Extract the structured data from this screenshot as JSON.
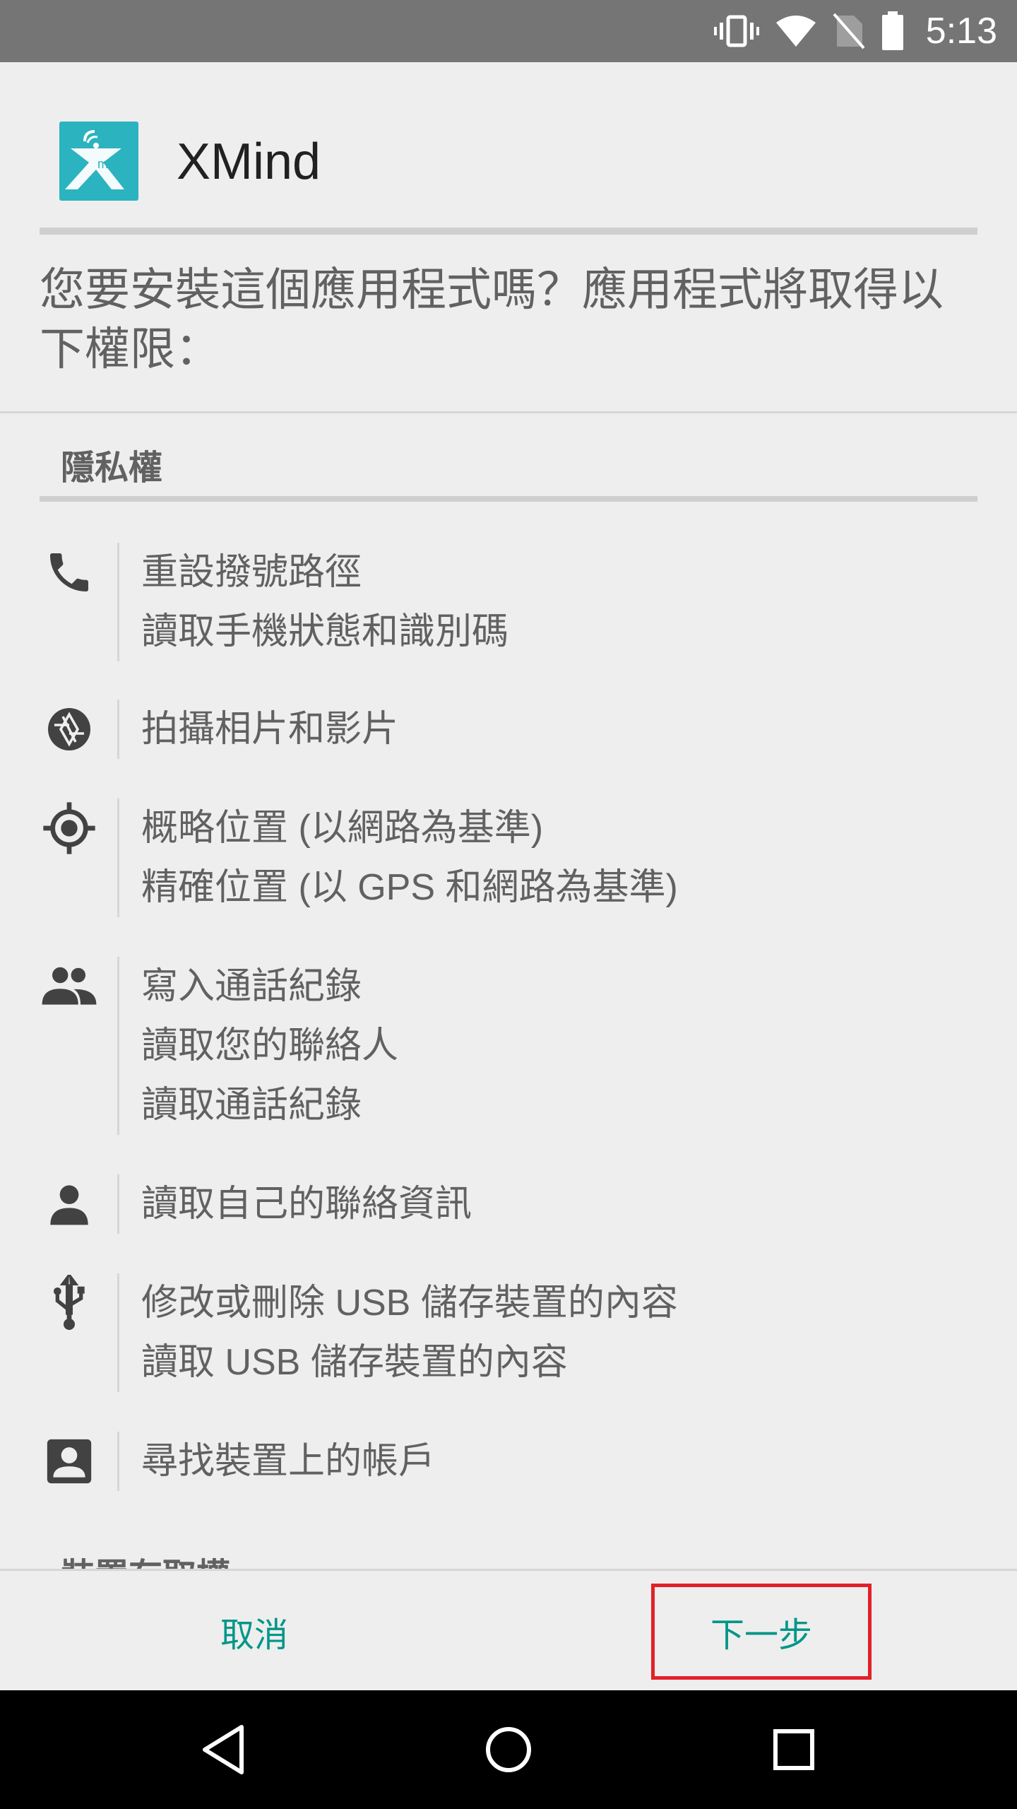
{
  "status_bar": {
    "time": "5:13",
    "icons": [
      "vibrate-icon",
      "wifi-icon",
      "no-sim-icon",
      "battery-icon"
    ]
  },
  "app": {
    "name": "XMind",
    "icon": "xmind-app-icon",
    "icon_color": "#2bb3bf"
  },
  "prompt": {
    "question": "您要安裝這個應用程式嗎？應用程式將取得以下權限："
  },
  "permissions": {
    "section_title": "隱私權",
    "groups": [
      {
        "icon": "phone-icon",
        "lines": [
          "重設撥號路徑",
          "讀取手機狀態和識別碼"
        ]
      },
      {
        "icon": "camera-shutter-icon",
        "lines": [
          "拍攝相片和影片"
        ]
      },
      {
        "icon": "location-target-icon",
        "lines": [
          "概略位置 (以網路為基準)",
          "精確位置 (以 GPS 和網路為基準)"
        ]
      },
      {
        "icon": "people-icon",
        "lines": [
          "寫入通話紀錄",
          "讀取您的聯絡人",
          "讀取通話紀錄"
        ]
      },
      {
        "icon": "person-icon",
        "lines": [
          "讀取自己的聯絡資訊"
        ]
      },
      {
        "icon": "usb-icon",
        "lines": [
          "修改或刪除 USB 儲存裝置的內容",
          "讀取 USB 儲存裝置的內容"
        ]
      },
      {
        "icon": "account-box-icon",
        "lines": [
          "尋找裝置上的帳戶"
        ]
      }
    ],
    "next_section_title": "裝置存取權"
  },
  "actions": {
    "cancel_label": "取消",
    "next_label": "下一步",
    "accent_color": "#009688",
    "highlight_color": "#e32028"
  },
  "navigation_bar": {
    "buttons": [
      "back-icon",
      "home-icon",
      "recents-icon"
    ]
  }
}
